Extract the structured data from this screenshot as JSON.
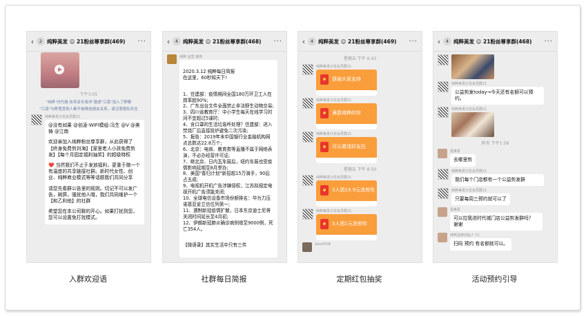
{
  "captions": [
    "入群欢迎语",
    "社群每日简报",
    "定期红包抽奖",
    "活动预约引导"
  ],
  "p1": {
    "unread": "2",
    "title": "纯粹美发 ☺ 21粉丝尊享群(469)",
    "time": "下午3:05",
    "sys1": "\"纯粹 时代城 技术店长海洋\"邀请\"江南\"加入了群聊",
    "sys2": "\"江南\"与群里其他人都不是微信朋友关系，请注意隐私安全",
    "sender": "纯粹美发沙龙会员群21",
    "paras": [
      "@没有如果 @创凌-WIFI模组-冯生 @V @美铸 @江南",
      "欢迎亲加入纯粹粉丝尊享群，从此获得了【终身免费剪刘海】【家里老人小孩免费剪发】【每个月固定福利抽奖】的超级特权",
      "❤️ 当然我们不止于发放福利，更重于做一个有温度的共享链接社群。新时代女性、创业、纯粹商业模式等等话题我们共同分享",
      "请您先看群公告里的规则。切记不可以发广告，刷屏，骚扰他人哦，我们共同维护一个【和乙利他】的社群",
      "希望您在本公司聊的开心。如果打扰到您，您可以设置免打扰模式。"
    ]
  },
  "p2": {
    "unread": "4",
    "title": "纯粹美发 ☺ 21粉丝尊享群(468)",
    "sender": "纯粹 运营 黄燕",
    "paras": [
      "2020.3.12 纯粹每日简报\n在这里，60秒知天下!",
      "1、住建部：疫情期间全国180万环卫工人在岗率超90%;\n2、广东出台文件全面禁止非法野生动物交易;\n3、四川省教育厅：中小学生每天在线学习时间不宜超过5课时;\n4、含口罩的生活垃圾咋处理？住建部：进入焚烧厂后直接投炉避免二次污染;\n5、报告：2019年末中国银行业金融机构网点总数达22.8万个;\n6、北京：电商、教育类等直播不属于网络表演，不必办经营许可证;\n7、继北京、日内瓦车展后，纽约车展也受疫情影响延期至8月举办;\n8、美国\"春归计划\"新招超15万骑手，90后占五成;\n9、电视机开机广告涉嫌侵权，江苏拟规定电视开机广告须能关闭;\n10、全球电信设备市场份额排名：华为力压诺基亚爱立信位列第一;\n11、遇制新冠疫情扩散，日本东京迪士尼将关闭时间延长至4月初;\n12、伊朗新冠肺炎确诊病例增至9000例，死亡354人。",
      "【微语录】其实生活中只有三件"
    ]
  },
  "p3": {
    "unread": "4",
    "title": "纯粹美发 ☺ 21粉丝尊享群(469)",
    "time1": "星期五 下午 6:43",
    "time2": "星期五 下午 8:50",
    "sender": "纯粹美发沙龙会员群21",
    "packets": [
      "感谢大家支持",
      "满意纯粹的你",
      "可以邀请好友拉",
      "3人团19.9元洗剪吹",
      "5人团1元洗剪吹"
    ],
    "last_sender": "alex0506"
  },
  "p4": {
    "unread": "4",
    "title": "纯粹美发 ☺ 21粉丝尊享群(468)",
    "sender": "纯粹美发沙龙会员群21",
    "msg1": "公益剪发today→今天还有名额可以预约。",
    "time": "昨天 下午1:58",
    "user1": "嘉莱素",
    "msg2": "去哪里剪",
    "msg3": "我们每个门店都有一个公益剪发群",
    "msg4": "只要每周三预约就可以了",
    "msg5": "可以拉我进时代城门店公益剪发群吗？ 谢谢",
    "user2": "纯粹品牌创始人 CC",
    "msg6": "扫码 预约 有名额就可以。"
  }
}
